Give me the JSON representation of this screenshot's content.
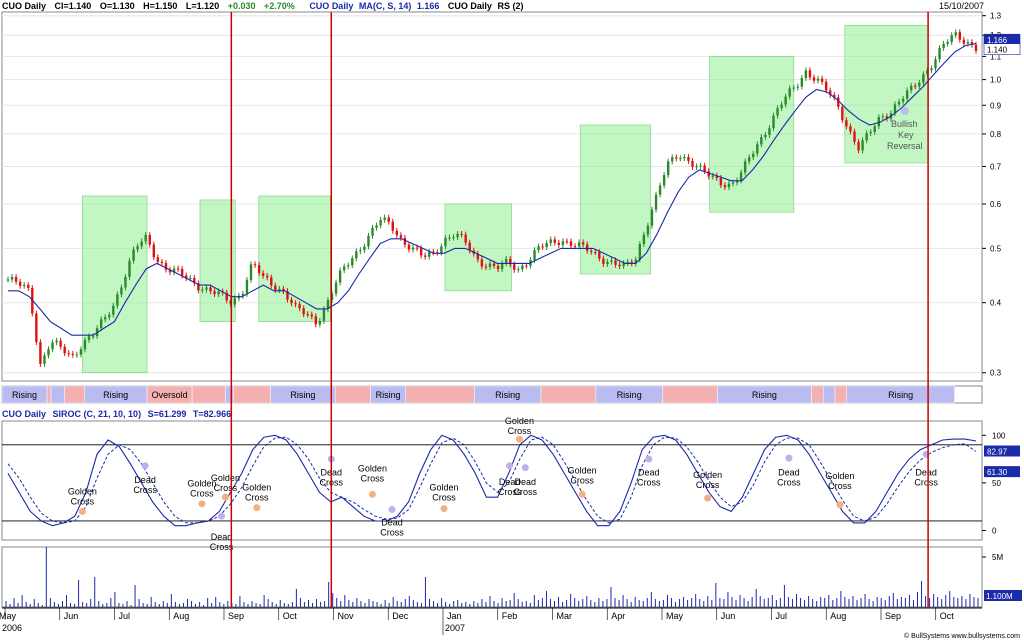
{
  "header": {
    "title": "CUO Daily",
    "close": "Cl=1.140",
    "open": "O=1.130",
    "high": "H=1.150",
    "low": "L=1.120",
    "change": "+0.030",
    "change_pct": "+2.70%",
    "ma_label": "CUO Daily",
    "ma_params": "MA(C, S, 14)",
    "ma_value": "1.166",
    "rs_label": "CUO Daily",
    "rs_params": "RS (2)",
    "date": "15/10/2007"
  },
  "siroc_header": {
    "label": "CUO Daily",
    "params": "SIROC (C, 21, 10, 10)",
    "s_value": "S=61.299",
    "t_value": "T=82.966"
  },
  "copyright": "© BullSystems  www.bullsystems.com",
  "colors": {
    "up_candle": "#2a8a2a",
    "down_candle": "#e01010",
    "ma_line": "#1a2aa8",
    "zone_fill": "#90ee90",
    "vertical_marker": "#cc0000",
    "rising_band": "#b8bcf0",
    "falling_band": "#f4b0b0"
  },
  "chart_data": [
    {
      "type": "line",
      "name": "price",
      "y_scale": "log",
      "y_ticks": [
        "1.3",
        "1.2",
        "1.1",
        "1.0",
        "0.9",
        "0.8",
        "0.7",
        "0.6",
        "0.5",
        "0.4",
        "0.3"
      ],
      "ylim": [
        0.29,
        1.32
      ],
      "current_labels": [
        "1.166",
        "1.140"
      ],
      "x_months": [
        "May",
        "Jun",
        "Jul",
        "Aug",
        "Sep",
        "Oct",
        "Nov",
        "Dec",
        "Jan",
        "Feb",
        "Mar",
        "Apr",
        "May",
        "Jun",
        "Jul",
        "Aug",
        "Sep",
        "Oct"
      ],
      "x_years": [
        "2006",
        "2007"
      ],
      "close_path": [
        0.44,
        0.43,
        0.42,
        0.31,
        0.34,
        0.33,
        0.32,
        0.34,
        0.35,
        0.37,
        0.4,
        0.45,
        0.5,
        0.52,
        0.48,
        0.46,
        0.45,
        0.44,
        0.43,
        0.42,
        0.41,
        0.4,
        0.42,
        0.47,
        0.44,
        0.43,
        0.42,
        0.39,
        0.38,
        0.37,
        0.4,
        0.44,
        0.47,
        0.5,
        0.53,
        0.56,
        0.55,
        0.52,
        0.5,
        0.48,
        0.49,
        0.52,
        0.53,
        0.51,
        0.48,
        0.47,
        0.46,
        0.47,
        0.46,
        0.48,
        0.5,
        0.51,
        0.52,
        0.51,
        0.5,
        0.49,
        0.48,
        0.47,
        0.46,
        0.48,
        0.55,
        0.62,
        0.7,
        0.74,
        0.72,
        0.69,
        0.67,
        0.66,
        0.65,
        0.68,
        0.74,
        0.8,
        0.86,
        0.92,
        0.97,
        1.04,
        1.0,
        0.95,
        0.9,
        0.82,
        0.75,
        0.8,
        0.86,
        0.88,
        0.92,
        0.96,
        1.02,
        1.08,
        1.15,
        1.2,
        1.18,
        1.14
      ],
      "ma_path": [
        0.42,
        0.42,
        0.41,
        0.39,
        0.37,
        0.36,
        0.35,
        0.35,
        0.35,
        0.36,
        0.37,
        0.4,
        0.43,
        0.46,
        0.47,
        0.46,
        0.45,
        0.44,
        0.43,
        0.43,
        0.42,
        0.41,
        0.41,
        0.42,
        0.43,
        0.42,
        0.42,
        0.41,
        0.4,
        0.39,
        0.39,
        0.4,
        0.42,
        0.45,
        0.48,
        0.51,
        0.52,
        0.52,
        0.51,
        0.5,
        0.49,
        0.49,
        0.5,
        0.5,
        0.49,
        0.48,
        0.47,
        0.47,
        0.47,
        0.47,
        0.48,
        0.49,
        0.5,
        0.5,
        0.5,
        0.5,
        0.49,
        0.48,
        0.47,
        0.47,
        0.49,
        0.53,
        0.58,
        0.63,
        0.67,
        0.69,
        0.68,
        0.67,
        0.66,
        0.66,
        0.69,
        0.73,
        0.78,
        0.83,
        0.88,
        0.93,
        0.96,
        0.95,
        0.92,
        0.88,
        0.85,
        0.83,
        0.84,
        0.86,
        0.89,
        0.93,
        0.97,
        1.02,
        1.07,
        1.12,
        1.15,
        1.16
      ],
      "zones": [
        {
          "x0": 0.082,
          "x1": 0.148,
          "y0": 0.3,
          "y1": 0.62
        },
        {
          "x0": 0.202,
          "x1": 0.238,
          "y0": 0.37,
          "y1": 0.61
        },
        {
          "x0": 0.262,
          "x1": 0.335,
          "y0": 0.37,
          "y1": 0.62
        },
        {
          "x0": 0.452,
          "x1": 0.52,
          "y0": 0.42,
          "y1": 0.6
        },
        {
          "x0": 0.59,
          "x1": 0.662,
          "y0": 0.45,
          "y1": 0.83
        },
        {
          "x0": 0.722,
          "x1": 0.808,
          "y0": 0.58,
          "y1": 1.1
        },
        {
          "x0": 0.86,
          "x1": 0.945,
          "y0": 0.71,
          "y1": 1.25
        }
      ],
      "annotation": "Bullish Key Reversal"
    },
    {
      "type": "bar",
      "name": "trend-band",
      "segments": [
        {
          "label": "Rising",
          "state": "rising",
          "w": 0.046
        },
        {
          "label": "",
          "state": "falling",
          "w": 0.004
        },
        {
          "label": "",
          "state": "rising",
          "w": 0.014
        },
        {
          "label": "",
          "state": "falling",
          "w": 0.02
        },
        {
          "label": "Rising",
          "state": "rising",
          "w": 0.064
        },
        {
          "label": "Oversold",
          "state": "falling",
          "w": 0.046
        },
        {
          "label": "",
          "state": "falling",
          "w": 0.034
        },
        {
          "label": "",
          "state": "rising",
          "w": 0.008
        },
        {
          "label": "",
          "state": "falling",
          "w": 0.038
        },
        {
          "label": "Rising",
          "state": "rising",
          "w": 0.066
        },
        {
          "label": "",
          "state": "falling",
          "w": 0.036
        },
        {
          "label": "Rising",
          "state": "rising",
          "w": 0.036
        },
        {
          "label": "",
          "state": "falling",
          "w": 0.07
        },
        {
          "label": "Rising",
          "state": "rising",
          "w": 0.068
        },
        {
          "label": "",
          "state": "falling",
          "w": 0.056
        },
        {
          "label": "Rising",
          "state": "rising",
          "w": 0.068
        },
        {
          "label": "",
          "state": "falling",
          "w": 0.056
        },
        {
          "label": "Rising",
          "state": "rising",
          "w": 0.096
        },
        {
          "label": "",
          "state": "falling",
          "w": 0.012
        },
        {
          "label": "",
          "state": "rising",
          "w": 0.012
        },
        {
          "label": "",
          "state": "falling",
          "w": 0.012
        },
        {
          "label": "Rising",
          "state": "rising",
          "w": 0.11
        }
      ]
    },
    {
      "type": "line",
      "name": "siroc",
      "y_ticks": [
        "100",
        "50",
        "0"
      ],
      "ylim": [
        -10,
        115
      ],
      "current_labels": [
        "82.97",
        "61.30"
      ],
      "s_path": [
        60,
        40,
        20,
        10,
        5,
        8,
        15,
        40,
        80,
        95,
        88,
        70,
        50,
        30,
        15,
        5,
        5,
        8,
        10,
        20,
        40,
        60,
        85,
        98,
        100,
        95,
        80,
        60,
        40,
        30,
        35,
        25,
        15,
        10,
        10,
        15,
        30,
        60,
        85,
        100,
        95,
        80,
        60,
        35,
        35,
        60,
        90,
        100,
        95,
        80,
        60,
        40,
        20,
        5,
        5,
        20,
        50,
        85,
        98,
        100,
        95,
        80,
        60,
        40,
        25,
        20,
        35,
        60,
        85,
        98,
        100,
        95,
        80,
        60,
        40,
        20,
        8,
        8,
        20,
        40,
        60,
        75,
        85,
        90,
        95,
        96,
        96,
        94
      ],
      "t_path": [
        70,
        55,
        35,
        18,
        10,
        8,
        10,
        25,
        55,
        80,
        90,
        85,
        70,
        50,
        30,
        15,
        8,
        8,
        10,
        15,
        28,
        45,
        68,
        88,
        97,
        98,
        90,
        75,
        55,
        40,
        35,
        30,
        22,
        15,
        12,
        13,
        22,
        45,
        70,
        92,
        97,
        90,
        72,
        50,
        40,
        50,
        75,
        95,
        98,
        90,
        72,
        52,
        32,
        15,
        8,
        12,
        35,
        68,
        90,
        98,
        97,
        88,
        72,
        52,
        35,
        25,
        30,
        48,
        72,
        90,
        97,
        97,
        90,
        72,
        52,
        32,
        15,
        10,
        14,
        28,
        46,
        62,
        74,
        82,
        87,
        90,
        91,
        83
      ],
      "labels": [
        {
          "text": "Golden Cross",
          "x": 0.082,
          "y": 38,
          "dot_y": 20
        },
        {
          "text": "Dead Cross",
          "x": 0.146,
          "y": 50,
          "dot_y": 68
        },
        {
          "text": "Golden Cross",
          "x": 0.204,
          "y": 46,
          "dot_y": 28
        },
        {
          "text": "Golden Cross",
          "x": 0.228,
          "y": 52,
          "dot_y": 35
        },
        {
          "text": "Dead Cross",
          "x": 0.224,
          "y": -10,
          "dot_y": 15
        },
        {
          "text": "Golden Cross",
          "x": 0.26,
          "y": 42,
          "dot_y": 24
        },
        {
          "text": "Dead Cross",
          "x": 0.336,
          "y": 58,
          "dot_y": 75
        },
        {
          "text": "Golden Cross",
          "x": 0.378,
          "y": 62,
          "dot_y": 38
        },
        {
          "text": "Dead Cross",
          "x": 0.398,
          "y": 5,
          "dot_y": 22
        },
        {
          "text": "Golden Cross",
          "x": 0.451,
          "y": 42,
          "dot_y": 23
        },
        {
          "text": "Golden Cross",
          "x": 0.528,
          "y": 112,
          "dot_y": 96
        },
        {
          "text": "Dead Cross",
          "x": 0.518,
          "y": 48,
          "dot_y": 68
        },
        {
          "text": "Dead Cross",
          "x": 0.534,
          "y": 48,
          "dot_y": 66
        },
        {
          "text": "Golden Cross",
          "x": 0.592,
          "y": 60,
          "dot_y": 38
        },
        {
          "text": "Dead Cross",
          "x": 0.66,
          "y": 58,
          "dot_y": 75
        },
        {
          "text": "Golden Cross",
          "x": 0.72,
          "y": 55,
          "dot_y": 34
        },
        {
          "text": "Dead Cross",
          "x": 0.803,
          "y": 58,
          "dot_y": 76
        },
        {
          "text": "Golden Cross",
          "x": 0.855,
          "y": 54,
          "dot_y": 27
        },
        {
          "text": "Dead Cross",
          "x": 0.943,
          "y": 58,
          "dot_y": 80
        }
      ]
    },
    {
      "type": "bar",
      "name": "volume",
      "y_ticks": [
        "5M",
        "1.100M"
      ],
      "ylim": [
        0,
        6
      ],
      "values": [
        0.6,
        0.3,
        0.9,
        0.4,
        1.2,
        0.5,
        0.3,
        0.8,
        0.4,
        0.2,
        6.0,
        0.9,
        0.5,
        0.3,
        0.6,
        1.2,
        0.4,
        0.3,
        2.7,
        0.5,
        0.4,
        0.8,
        3.0,
        0.6,
        0.3,
        0.4,
        0.9,
        1.5,
        0.4,
        0.3,
        0.6,
        0.2,
        2.2,
        0.8,
        0.4,
        0.3,
        1.0,
        0.5,
        0.3,
        0.6,
        0.4,
        1.3,
        0.5,
        0.3,
        0.4,
        0.8,
        0.6,
        0.3,
        0.5,
        0.2,
        0.9,
        0.4,
        1.0,
        0.5,
        0.3,
        0.6,
        0.4,
        0.3,
        1.1,
        0.5,
        0.3,
        0.6,
        0.4,
        0.3,
        1.2,
        0.8,
        0.5,
        0.3,
        0.7,
        0.4,
        0.3,
        0.5,
        1.8,
        0.9,
        0.5,
        0.7,
        0.4,
        0.8,
        0.5,
        0.6,
        2.5,
        1.4,
        0.9,
        0.6,
        1.2,
        0.7,
        0.5,
        0.9,
        0.6,
        0.4,
        0.8,
        0.6,
        0.5,
        0.3,
        0.7,
        0.4,
        1.0,
        0.6,
        0.5,
        0.8,
        1.1,
        0.7,
        0.5,
        0.4,
        3.0,
        0.8,
        0.6,
        0.4,
        0.9,
        0.5,
        0.3,
        0.6,
        0.7,
        0.4,
        0.5,
        0.3,
        0.6,
        0.4,
        0.8,
        0.5,
        1.1,
        0.6,
        0.4,
        0.9,
        0.6,
        0.7,
        1.4,
        0.8,
        0.5,
        0.6,
        0.4,
        1.2,
        0.7,
        0.9,
        1.6,
        0.8,
        0.6,
        1.0,
        0.5,
        0.7,
        1.3,
        0.9,
        0.6,
        0.8,
        1.1,
        0.7,
        0.5,
        0.9,
        0.6,
        0.8,
        2.0,
        0.9,
        0.7,
        1.2,
        0.8,
        0.5,
        1.0,
        0.7,
        0.6,
        0.9,
        1.5,
        0.8,
        0.6,
        0.7,
        1.2,
        0.9,
        0.5,
        0.8,
        1.0,
        0.7,
        0.9,
        1.3,
        0.8,
        0.6,
        1.1,
        0.7,
        2.4,
        0.9,
        0.8,
        1.5,
        1.0,
        0.7,
        1.2,
        0.9,
        0.6,
        1.0,
        1.8,
        1.1,
        0.8,
        0.9,
        1.2,
        0.7,
        0.9,
        2.2,
        1.0,
        0.8,
        1.3,
        0.9,
        0.7,
        1.1,
        0.8,
        0.6,
        1.0,
        0.9,
        1.2,
        0.7,
        0.9,
        1.6,
        1.0,
        0.8,
        1.1,
        0.7,
        0.9,
        1.3,
        0.8,
        0.6,
        1.0,
        0.9,
        0.7,
        1.1,
        1.4,
        0.8,
        1.0,
        0.9,
        1.2,
        0.7,
        1.5,
        2.6,
        1.1,
        0.9,
        1.3,
        1.0,
        0.8,
        1.2,
        1.6,
        1.0,
        0.9,
        1.1,
        0.8,
        1.3,
        1.0,
        0.9
      ]
    }
  ],
  "vertical_markers": [
    0.234,
    0.336,
    0.945
  ]
}
